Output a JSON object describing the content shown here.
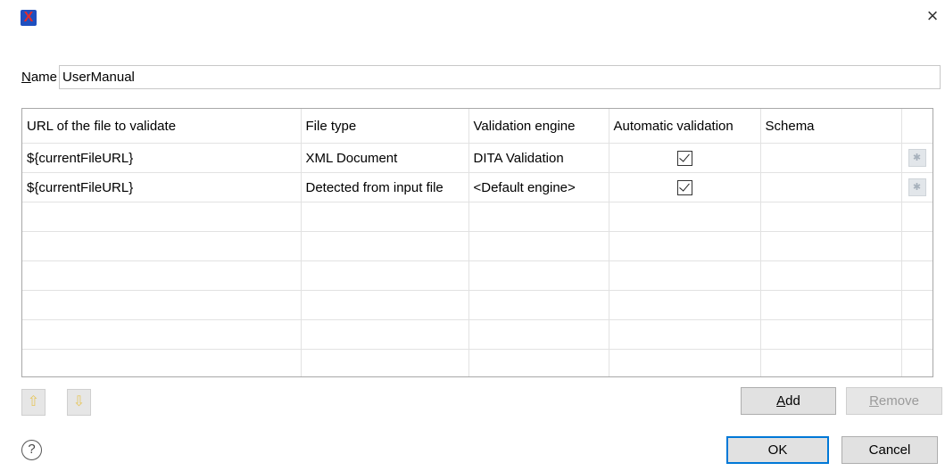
{
  "window": {
    "app_icon": "X",
    "close_glyph": "×"
  },
  "name_field": {
    "label_mnemonic": "N",
    "label_rest": "ame",
    "value": "UserManual"
  },
  "table": {
    "columns": [
      "URL of the file to validate",
      "File type",
      "Validation engine",
      "Automatic validation",
      "Schema",
      ""
    ],
    "rows": [
      {
        "url": "${currentFileURL}",
        "file_type": "XML Document",
        "engine": "DITA Validation",
        "auto": true,
        "schema": ""
      },
      {
        "url": "${currentFileURL}",
        "file_type": "Detected from input file",
        "engine": "<Default engine>",
        "auto": true,
        "schema": ""
      }
    ],
    "empty_rows": 6
  },
  "buttons": {
    "move_up_icon": "arrow-up-icon",
    "move_down_icon": "arrow-down-icon",
    "add_mnemonic": "A",
    "add_rest": "dd",
    "remove_mnemonic": "R",
    "remove_rest": "emove",
    "ok": "OK",
    "cancel": "Cancel",
    "help": "?"
  }
}
